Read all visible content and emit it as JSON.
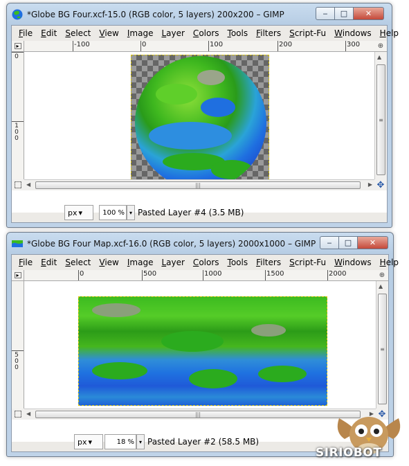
{
  "menu": [
    "File",
    "Edit",
    "Select",
    "View",
    "Image",
    "Layer",
    "Colors",
    "Tools",
    "Filters",
    "Script-Fu",
    "Windows",
    "Help"
  ],
  "window_a": {
    "title": "*Globe BG Four.xcf-15.0 (RGB color, 5 layers) 200x200 – GIMP",
    "ruler_h": [
      "-100",
      "0",
      "100",
      "200",
      "300"
    ],
    "ruler_v": [
      "0",
      "1",
      "0",
      "0"
    ],
    "unit": "px",
    "zoom": "100 %",
    "status": "Pasted Layer #4 (3.5 MB)",
    "icon": "globe-icon"
  },
  "window_b": {
    "title": "*Globe BG Four Map.xcf-16.0 (RGB color, 5 layers) 2000x1000 – GIMP",
    "ruler_h": [
      "0",
      "500",
      "1000",
      "1500",
      "2000"
    ],
    "ruler_v": [
      "5",
      "0",
      "0"
    ],
    "unit": "px",
    "zoom": "18 %",
    "status": "Pasted Layer #2 (58.5 MB)",
    "icon": "map-icon"
  },
  "window_buttons": {
    "minimize": "‒",
    "maximize": "□",
    "close": "✕"
  },
  "watermark": "SIRIOBOT",
  "colors": {
    "land": "#3cbb20",
    "ocean": "#1f6fe0",
    "selection": "#d5c000"
  }
}
